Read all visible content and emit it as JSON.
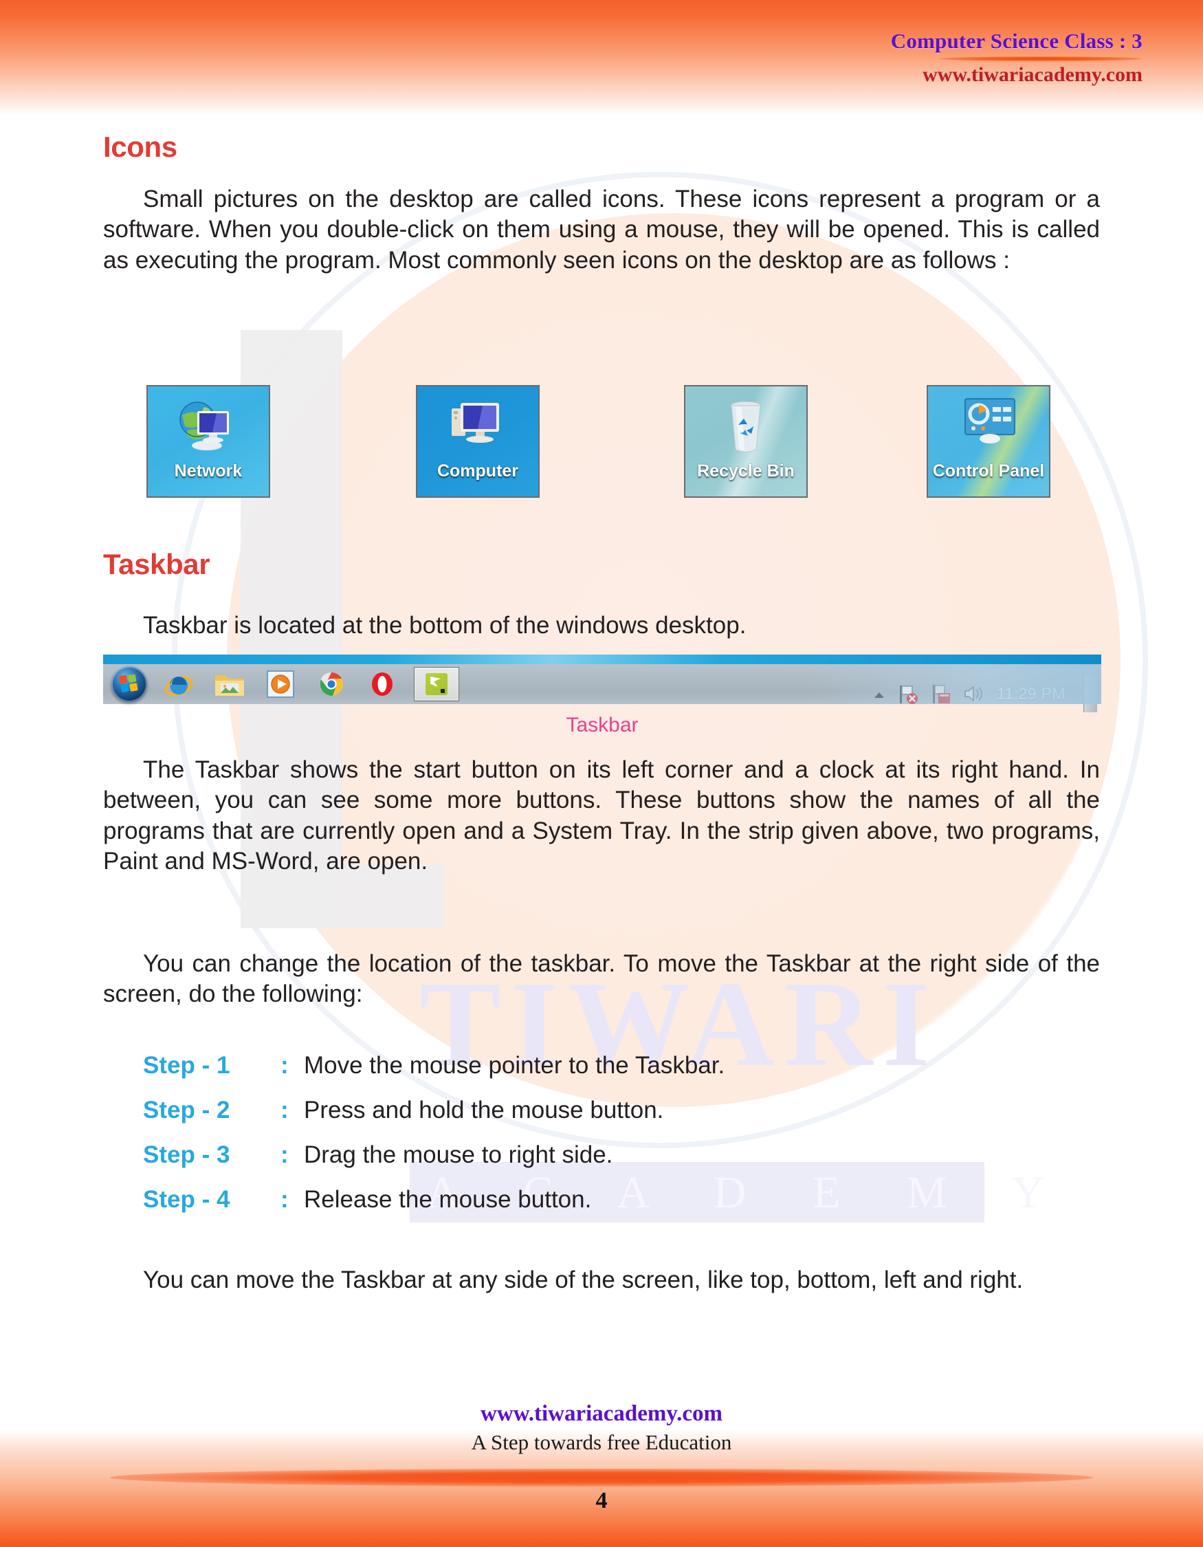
{
  "header": {
    "title": "Computer Science Class : 3",
    "website": "www.tiwariacademy.com"
  },
  "watermark": {
    "primary": "TIWARI",
    "secondary": "A C A D E M Y"
  },
  "sections": {
    "icons": {
      "heading": "Icons",
      "paragraph": "Small pictures on the desktop are called icons. These icons represent a program or a software. When you double-click on them using a mouse, they will be opened. This is called as executing the program. Most commonly seen icons on the desktop are as follows :",
      "desktop_icons": [
        {
          "label": "Network",
          "icon": "network-globe-monitor-icon"
        },
        {
          "label": "Computer",
          "icon": "computer-monitor-icon"
        },
        {
          "label": "Recycle Bin",
          "icon": "recycle-bin-icon"
        },
        {
          "label": "Control Panel",
          "icon": "control-panel-icon"
        }
      ]
    },
    "taskbar": {
      "heading": "Taskbar",
      "intro": "Taskbar is located at the bottom of the windows desktop.",
      "caption": "Taskbar",
      "strip": {
        "start_button": "start-orb-windows-icon",
        "quick_launch": [
          "internet-explorer-icon",
          "file-explorer-folder-icon",
          "windows-media-player-icon",
          "google-chrome-icon",
          "opera-browser-icon"
        ],
        "open_program": "paint-program-icon",
        "tray": {
          "show_hidden": "chevron-up-icon",
          "network": "network-flag-error-icon",
          "action_center": "action-center-flag-icon",
          "volume": "speaker-volume-icon",
          "clock": "11:29 PM",
          "show_desktop": "show-desktop-strip"
        }
      },
      "paragraph_1": "The Taskbar shows the start button on its left corner and a clock at its right hand. In between, you can see some more buttons. These buttons show the names of all the programs that are currently open and a System Tray. In the strip given above, two programs, Paint and MS-Word, are open.",
      "paragraph_2": "You can change the location of the taskbar. To move the Taskbar at the right side of the screen, do the following:",
      "steps": [
        {
          "label": "Step - 1",
          "colon": ":",
          "text": "Move the mouse pointer to the Taskbar."
        },
        {
          "label": "Step - 2",
          "colon": ":",
          "text": "Press and hold the mouse button."
        },
        {
          "label": "Step - 3",
          "colon": ":",
          "text": "Drag the mouse to right side."
        },
        {
          "label": "Step - 4",
          "colon": ":",
          "text": "Release the mouse button."
        }
      ],
      "paragraph_3": "You can move the Taskbar at any side of the screen, like top, bottom, left and right."
    }
  },
  "footer": {
    "website": "www.tiwariacademy.com",
    "tagline": "A Step towards free Education",
    "page_number": "4"
  },
  "colors": {
    "heading_red": "#e23b35",
    "header_purple": "#5b0fd0",
    "header_red": "#c01c22",
    "step_blue": "#27a8e0",
    "caption_pink": "#e8418d",
    "band_orange": "#f4622c"
  }
}
